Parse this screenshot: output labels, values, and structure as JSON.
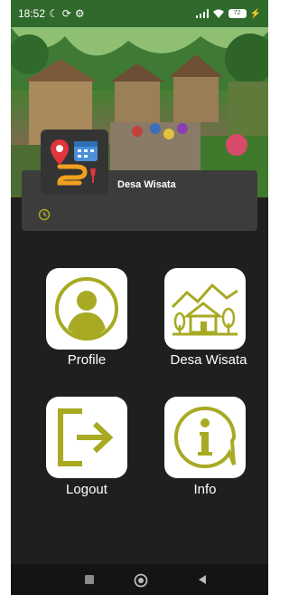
{
  "status_bar": {
    "time": "18:52",
    "battery_level": "72"
  },
  "header": {
    "title": "Desa Wisata"
  },
  "menu": {
    "profile": "Profile",
    "desa_wisata": "Desa Wisata",
    "logout": "Logout",
    "info": "Info"
  },
  "colors": {
    "accent": "#a7aa22",
    "status_bar": "#2f6a2c",
    "background": "#1f1f1f"
  }
}
